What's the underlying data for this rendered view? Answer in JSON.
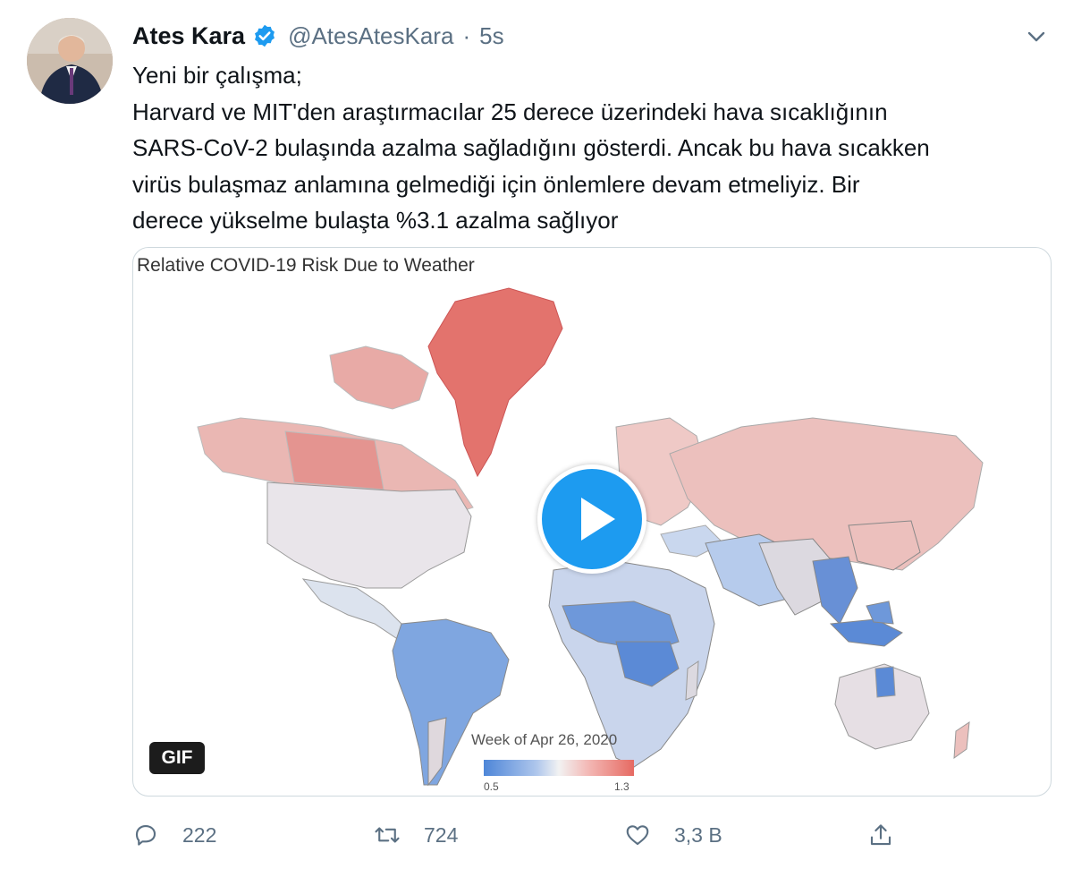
{
  "tweet": {
    "name": "Ates Kara",
    "handle": "@AtesAtesKara",
    "separator": "·",
    "time": "5s",
    "lines": [
      "Yeni bir çalışma;",
      "Harvard ve MIT'den araştırmacılar 25 derece üzerindeki hava sıcaklığının",
      "SARS-CoV-2 bulaşında azalma sağladığını gösterdi. Ancak bu hava sıcakken",
      "virüs bulaşmaz anlamına gelmediği için önlemlere devam etmeliyiz. Bir",
      "derece yükselme bulaşta %3.1 azalma sağlıyor"
    ]
  },
  "media": {
    "chart_title": "Relative COVID-19 Risk Due to Weather",
    "gif_label": "GIF",
    "legend_title": "Week of Apr 26, 2020",
    "legend_min": "0.5",
    "legend_max": "1.3",
    "colors": {
      "low": "#4e86d8",
      "mid": "#f2f2f2",
      "high": "#e66a62"
    }
  },
  "actions": {
    "reply_count": "222",
    "retweet_count": "724",
    "like_count": "3,3 B"
  },
  "icons": [
    "verified-icon",
    "chevron-down-icon",
    "play-icon",
    "reply-icon",
    "retweet-icon",
    "like-icon",
    "share-icon"
  ]
}
